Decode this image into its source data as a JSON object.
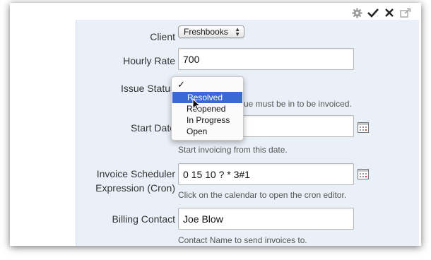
{
  "toolbar": {
    "icons": [
      "gear-icon",
      "check-icon",
      "close-icon",
      "popout-icon"
    ]
  },
  "form": {
    "client_label": "Client",
    "client_value": "Freshbooks",
    "rate_label": "Hourly Rate",
    "rate_value": "700",
    "status_label": "Issue Status",
    "status_help": "ue must be in to be invoiced.",
    "status_options": {
      "check": "✓",
      "resolved": "Resolved",
      "reopened": "Reopened",
      "inprogress": "In Progress",
      "open": "Open"
    },
    "start_label": "Start Date",
    "start_value": "",
    "start_help": "Start invoicing from this date.",
    "cron_label_1": "Invoice Scheduler",
    "cron_label_2": "Expression (Cron)",
    "cron_value": "0 15 10 ? * 3#1",
    "cron_help": "Click on the calendar to open the cron editor.",
    "contact_label": "Billing Contact",
    "contact_value": "Joe Blow",
    "contact_help": "Contact Name to send invoices to."
  },
  "colors": {
    "panel_bg": "#eaf0f8",
    "selection": "#3a69d6"
  }
}
